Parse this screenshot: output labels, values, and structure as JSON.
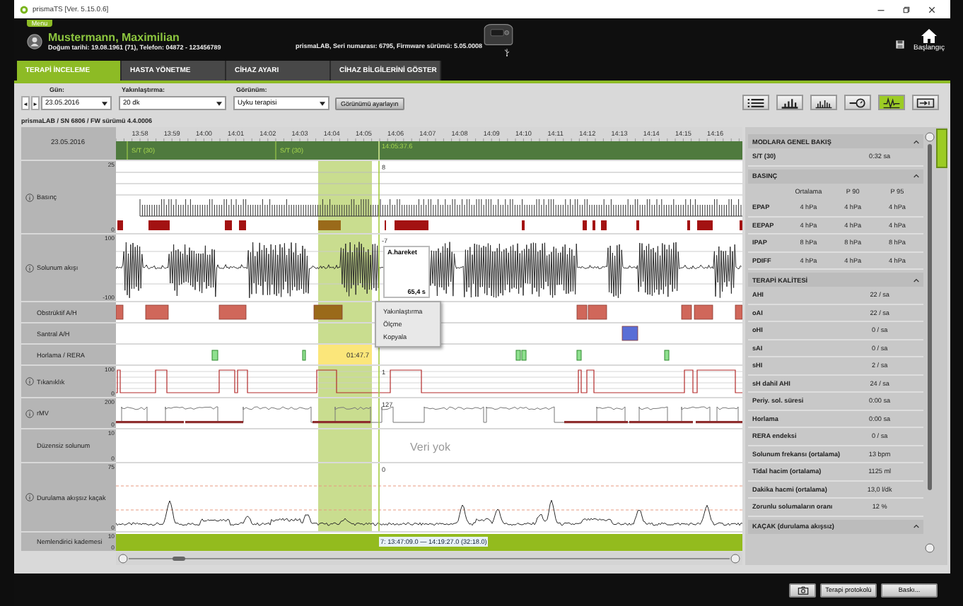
{
  "window": {
    "title": "prismaTS [Ver. 5.15.0.6]"
  },
  "header": {
    "menu": "Menu",
    "patient_name": "Mustermann, Maximilian",
    "patient_details": "Doğum tarihi: 19.08.1961 (71),  Telefon: 04872 - 123456789",
    "device_info": "prismaLAB,  Seri numarası: 6795,  Firmware sürümü: 5.05.0008",
    "home_label": "Başlangıç"
  },
  "tabs": [
    {
      "label": "TERAPİ İNCELEME",
      "selected": true
    },
    {
      "label": "HASTA YÖNETME",
      "selected": false
    },
    {
      "label": "CİHAZ AYARI",
      "selected": false
    },
    {
      "label": "CİHAZ BİLGİLERİNİ GÖSTER",
      "selected": false
    }
  ],
  "toolbar": {
    "day_label": "Gün:",
    "prev": "◄",
    "next": "►",
    "day": "23.05.2016",
    "zoom_label": "Yakınlaştırma:",
    "zoom": "20 dk",
    "view_label": "Görünüm:",
    "view": "Uyku terapisi",
    "view_button": "Görünümü ayarlayın",
    "view_modes": [
      {
        "kind": "list",
        "selected": false
      },
      {
        "kind": "bars",
        "selected": false
      },
      {
        "kind": "histogram",
        "selected": false
      },
      {
        "kind": "gauge",
        "selected": false
      },
      {
        "kind": "waveform",
        "selected": true
      },
      {
        "kind": "device",
        "selected": false
      }
    ]
  },
  "device_line": "prismaLAB / SN 6806 / FW sürümü 4.4.0006",
  "timeline": {
    "date": "23.05.2016",
    "times": [
      "13:58",
      "13:59",
      "14:00",
      "14:01",
      "14:02",
      "14:03",
      "14:04",
      "14:05",
      "14:06",
      "14:07",
      "14:08",
      "14:09",
      "14:10",
      "14:11",
      "14:12",
      "14:13",
      "14:14",
      "14:15",
      "14:16"
    ],
    "modes": [
      {
        "label": "S/T (30)"
      },
      {
        "label": "S/T (30)"
      }
    ],
    "cursor_time": "14:05:37.6"
  },
  "tracks": [
    {
      "kind": "pressure",
      "label": "Basınç",
      "info": true,
      "y_max": "25",
      "y_min": "0",
      "cursor_value": "8"
    },
    {
      "kind": "flow",
      "label": "Solunum akışı",
      "info": true,
      "y_max": "100",
      "y_min": "-100",
      "cursor_value": "-7",
      "annotation": {
        "label": "A.hareket",
        "duration": "65,4 s"
      }
    },
    {
      "kind": "obstructive",
      "label": "Obstrüktif A/H",
      "info": false
    },
    {
      "kind": "central",
      "label": "Santral A/H",
      "info": false
    },
    {
      "kind": "snore",
      "label": "Horlama / RERA",
      "info": false,
      "highlight": "01:47.7"
    },
    {
      "kind": "obstruction",
      "label": "Tıkanıklık",
      "info": true,
      "y_max": "100",
      "y_min": "0",
      "cursor_value": "1"
    },
    {
      "kind": "rmv",
      "label": "rMV",
      "info": true,
      "y_max": "200",
      "y_min": "0",
      "cursor_value": "127"
    },
    {
      "kind": "irregular",
      "label": "Düzensiz solunum",
      "info": false,
      "y_max": "10",
      "y_min": "0",
      "no_data": "Veri yok"
    },
    {
      "kind": "leak",
      "label": "Durulama akışsız kaçak",
      "info": true,
      "y_max": "75",
      "y_min": "0",
      "cursor_value": "0"
    },
    {
      "kind": "humidifier",
      "label": "Nemlendirici kademesi",
      "info": false,
      "y_max": "10",
      "y_min": "0",
      "range_label": "7: 13:47:09.0 — 14:19:27.0 (32:18.0)"
    }
  ],
  "context_menu": [
    "Yakınlaştırma",
    "Ölçme",
    "Kopyala"
  ],
  "panel": {
    "sections": [
      {
        "title": "MODLARA GENEL BAKIŞ",
        "rows": [
          {
            "label": "S/T (30)",
            "values": [
              "0:32 sa"
            ]
          }
        ]
      },
      {
        "title": "BASINÇ",
        "columns": [
          "Ortalama",
          "P 90",
          "P 95"
        ],
        "rows": [
          {
            "label": "EPAP",
            "values": [
              "4 hPa",
              "4 hPa",
              "4 hPa"
            ]
          },
          {
            "label": "EEPAP",
            "values": [
              "4 hPa",
              "4 hPa",
              "4 hPa"
            ]
          },
          {
            "label": "IPAP",
            "values": [
              "8 hPa",
              "8 hPa",
              "8 hPa"
            ]
          },
          {
            "label": "PDIFF",
            "values": [
              "4 hPa",
              "4 hPa",
              "4 hPa"
            ]
          }
        ]
      },
      {
        "title": "TERAPİ KALİTESİ",
        "rows": [
          {
            "label": "AHI",
            "values": [
              "22 / sa"
            ]
          },
          {
            "label": "oAI",
            "values": [
              "22 / sa"
            ]
          },
          {
            "label": "oHI",
            "values": [
              "0 / sa"
            ]
          },
          {
            "label": "sAI",
            "values": [
              "0 / sa"
            ]
          },
          {
            "label": "sHI",
            "values": [
              "2 / sa"
            ]
          },
          {
            "label": "sH dahil AHI",
            "values": [
              "24 / sa"
            ]
          },
          {
            "label": "Periy. sol. süresi",
            "values": [
              "0:00 sa"
            ]
          },
          {
            "label": "Horlama",
            "values": [
              "0:00 sa"
            ]
          },
          {
            "label": "RERA endeksi",
            "values": [
              "0 / sa"
            ]
          },
          {
            "label": "Solunum frekansı (ortalama)",
            "values": [
              "13 bpm"
            ]
          },
          {
            "label": "Tidal hacim (ortalama)",
            "values": [
              "1125 ml"
            ]
          },
          {
            "label": "Dakika hacmi (ortalama)",
            "values": [
              "13,0 l/dk"
            ]
          },
          {
            "label": "Zorunlu solumaların oranı",
            "values": [
              "12 %"
            ]
          }
        ]
      },
      {
        "title": "KAÇAK (durulama akışsız)"
      }
    ]
  },
  "footer": {
    "buttons": [
      {
        "kind": "camera"
      },
      {
        "kind": "text",
        "label": "Terapi protokolü"
      },
      {
        "kind": "text",
        "label": "Baskı..."
      }
    ]
  }
}
